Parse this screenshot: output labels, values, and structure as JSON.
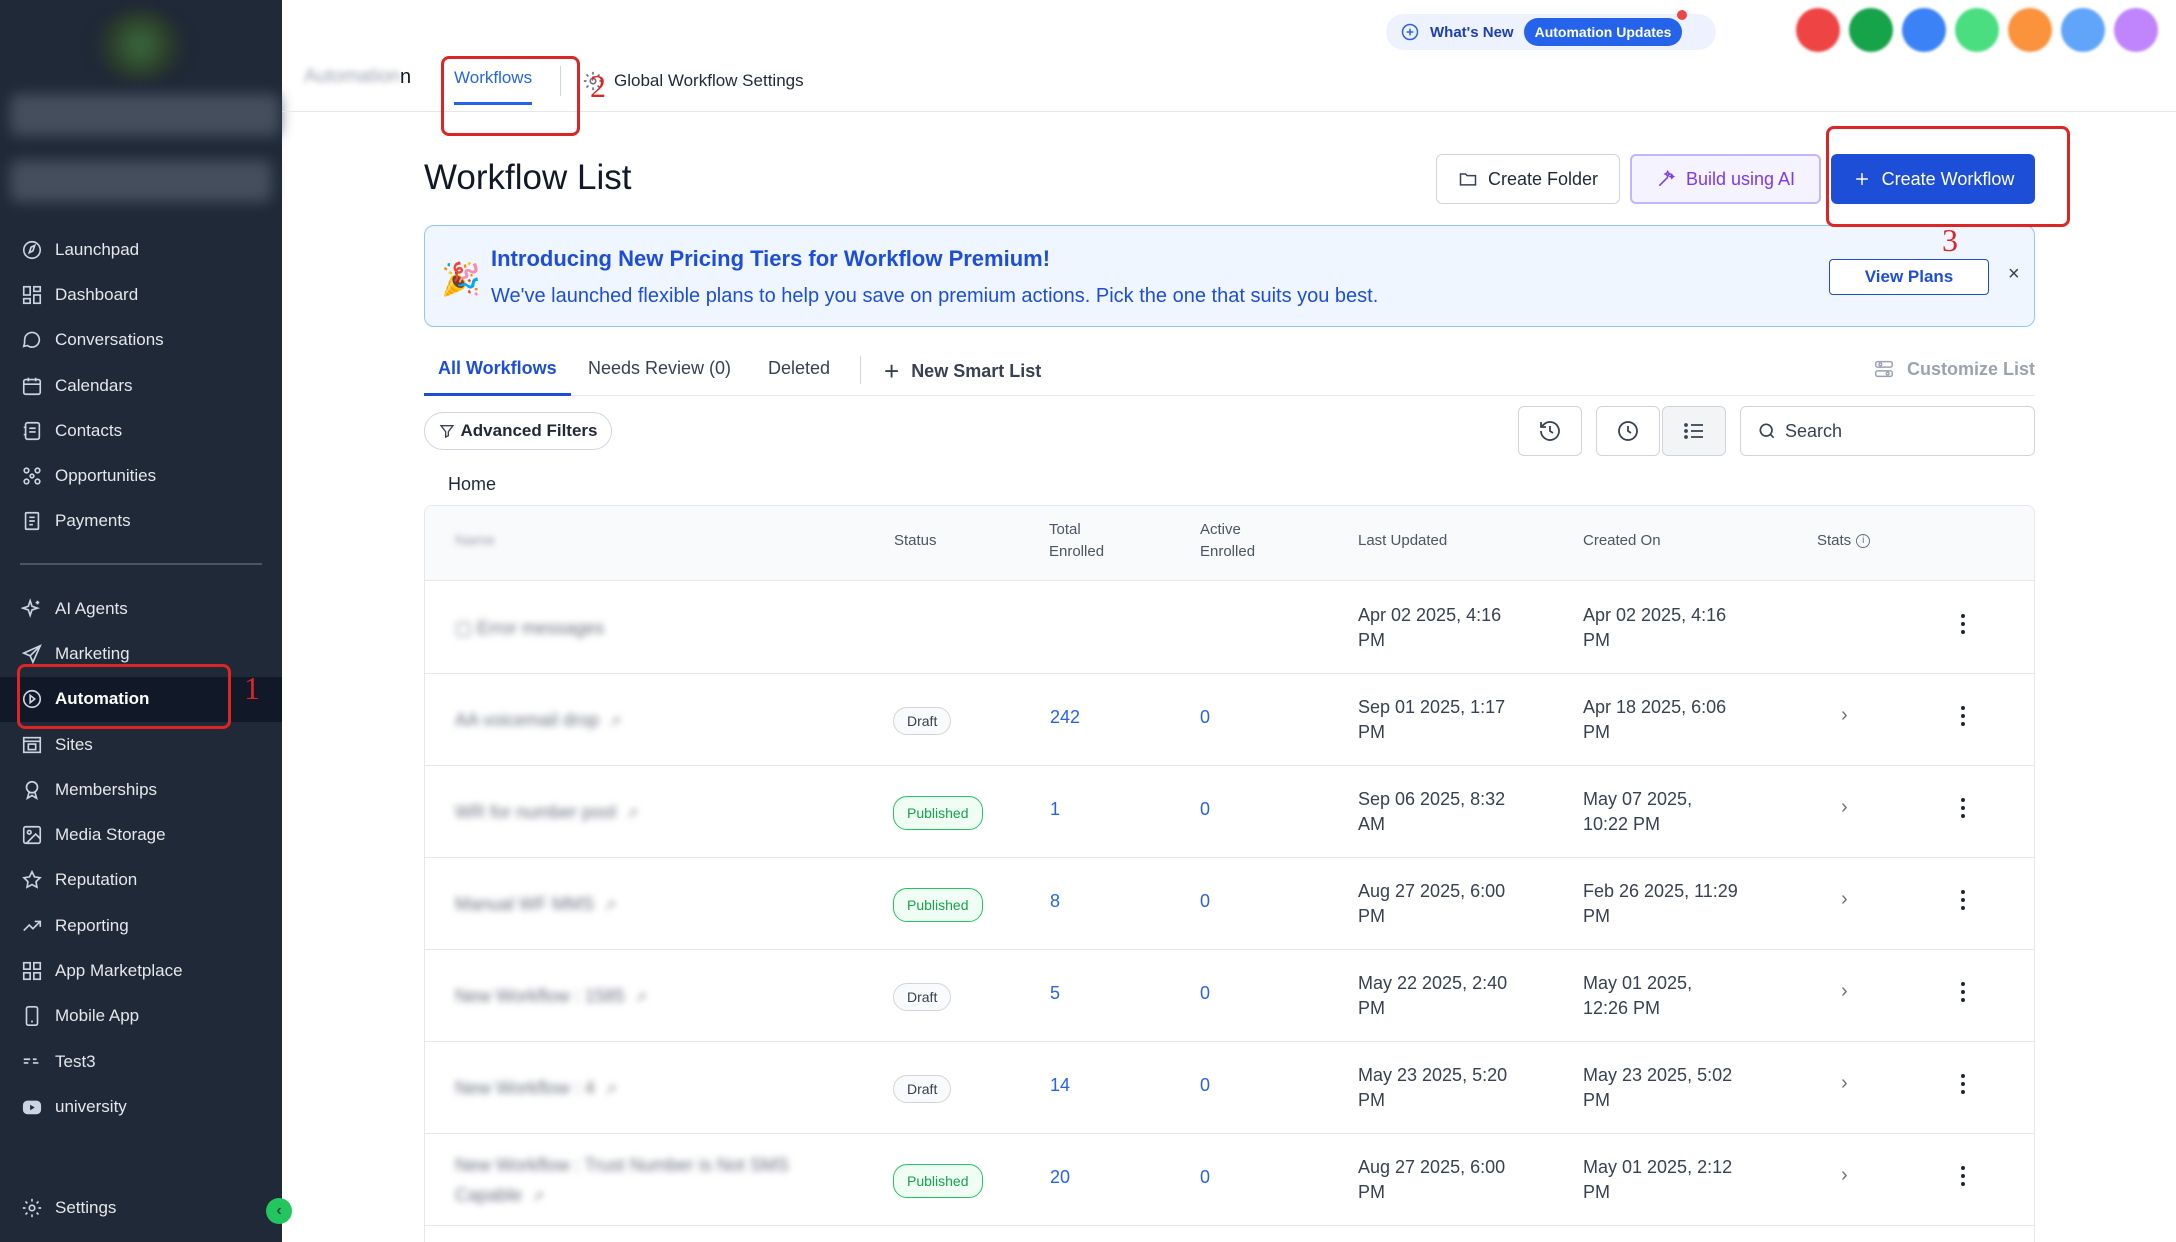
{
  "sidebar": {
    "nav_top": [
      {
        "label": "Launchpad",
        "icon": "launchpad-icon"
      },
      {
        "label": "Dashboard",
        "icon": "dashboard-icon"
      },
      {
        "label": "Conversations",
        "icon": "chat-bubble-icon"
      },
      {
        "label": "Calendars",
        "icon": "calendar-icon"
      },
      {
        "label": "Contacts",
        "icon": "contacts-icon"
      },
      {
        "label": "Opportunities",
        "icon": "opportunities-icon"
      },
      {
        "label": "Payments",
        "icon": "payments-icon"
      }
    ],
    "nav_bottom": [
      {
        "label": "AI Agents",
        "icon": "sparkle-icon"
      },
      {
        "label": "Marketing",
        "icon": "send-icon"
      },
      {
        "label": "Automation",
        "icon": "automation-icon",
        "active": true
      },
      {
        "label": "Sites",
        "icon": "sites-icon"
      },
      {
        "label": "Memberships",
        "icon": "memberships-icon"
      },
      {
        "label": "Media Storage",
        "icon": "image-icon"
      },
      {
        "label": "Reputation",
        "icon": "star-icon"
      },
      {
        "label": "Reporting",
        "icon": "trend-icon"
      },
      {
        "label": "App Marketplace",
        "icon": "grid-icon"
      },
      {
        "label": "Mobile App",
        "icon": "mobile-icon"
      },
      {
        "label": "Test3",
        "icon": "custom-icon"
      },
      {
        "label": "university",
        "icon": "video-icon"
      }
    ],
    "settings_label": "Settings",
    "collapse_glyph": "‹"
  },
  "topbar": {
    "breadcrumb_blurred": "Automation",
    "breadcrumb_visible": "n",
    "tab_workflows": "Workflows",
    "tab_global_settings": "Global Workflow Settings",
    "whats_new": "What's New",
    "automation_updates": "Automation Updates",
    "avatar_colors": [
      "#ef4444",
      "#16a34a",
      "#3b82f6",
      "#4ade80",
      "#fb923c",
      "#60a5fa",
      "#c084fc"
    ]
  },
  "main": {
    "title": "Workflow List",
    "btn_create_folder": "Create Folder",
    "btn_build_ai": "Build using AI",
    "btn_create_workflow": "Create Workflow",
    "banner": {
      "emoji": "🎉",
      "title": "Introducing New Pricing Tiers for Workflow Premium!",
      "subtitle": "We've launched flexible plans to help you save on premium actions. Pick the one that suits you best.",
      "cta": "View Plans",
      "close": "×"
    },
    "tabs": {
      "all": "All Workflows",
      "needs_review": "Needs Review (0)",
      "deleted": "Deleted",
      "new_smart_list": "New Smart List",
      "customize": "Customize List"
    },
    "advanced_filters": "Advanced Filters",
    "search_placeholder": "Search",
    "folder_label": "Home",
    "table": {
      "headers": {
        "name": "Name",
        "status": "Status",
        "total_line1": "Total",
        "total_line2": "Enrolled",
        "active_line1": "Active",
        "active_line2": "Enrolled",
        "last_updated": "Last Updated",
        "created_on": "Created On",
        "stats": "Stats"
      },
      "rows": [
        {
          "name": "Error messages",
          "status": "",
          "total": "",
          "active": "",
          "updated_1": "Apr 02 2025, 4:16",
          "updated_2": "PM",
          "created_1": "Apr 02 2025, 4:16",
          "created_2": "PM",
          "is_folder": true
        },
        {
          "name": "AA voicemail drop",
          "status": "Draft",
          "total": "242",
          "active": "0",
          "updated_1": "Sep 01 2025, 1:17",
          "updated_2": "PM",
          "created_1": "Apr 18 2025, 6:06",
          "created_2": "PM"
        },
        {
          "name": "WR for number pool",
          "status": "Published",
          "total": "1",
          "active": "0",
          "updated_1": "Sep 06 2025, 8:32",
          "updated_2": "AM",
          "created_1": "May 07 2025,",
          "created_2": "10:22 PM"
        },
        {
          "name": "Manual WF MMS",
          "status": "Published",
          "total": "8",
          "active": "0",
          "updated_1": "Aug 27 2025, 6:00",
          "updated_2": "PM",
          "created_1": "Feb 26 2025, 11:29",
          "created_2": "PM"
        },
        {
          "name": "New Workflow : 1585",
          "status": "Draft",
          "total": "5",
          "active": "0",
          "updated_1": "May 22 2025, 2:40",
          "updated_2": "PM",
          "created_1": "May 01 2025,",
          "created_2": "12:26 PM"
        },
        {
          "name": "New Workflow : 4",
          "status": "Draft",
          "total": "14",
          "active": "0",
          "updated_1": "May 23 2025, 5:20",
          "updated_2": "PM",
          "created_1": "May 23 2025, 5:02",
          "created_2": "PM"
        },
        {
          "name": "New Workflow : Trust Number is Not SMS",
          "name_2": "Capable",
          "status": "Published",
          "total": "20",
          "active": "0",
          "updated_1": "Aug 27 2025, 6:00",
          "updated_2": "PM",
          "created_1": "May 01 2025, 2:12",
          "created_2": "PM"
        }
      ]
    }
  },
  "annotations": {
    "n1": "1",
    "n2": "2",
    "n3": "3"
  }
}
